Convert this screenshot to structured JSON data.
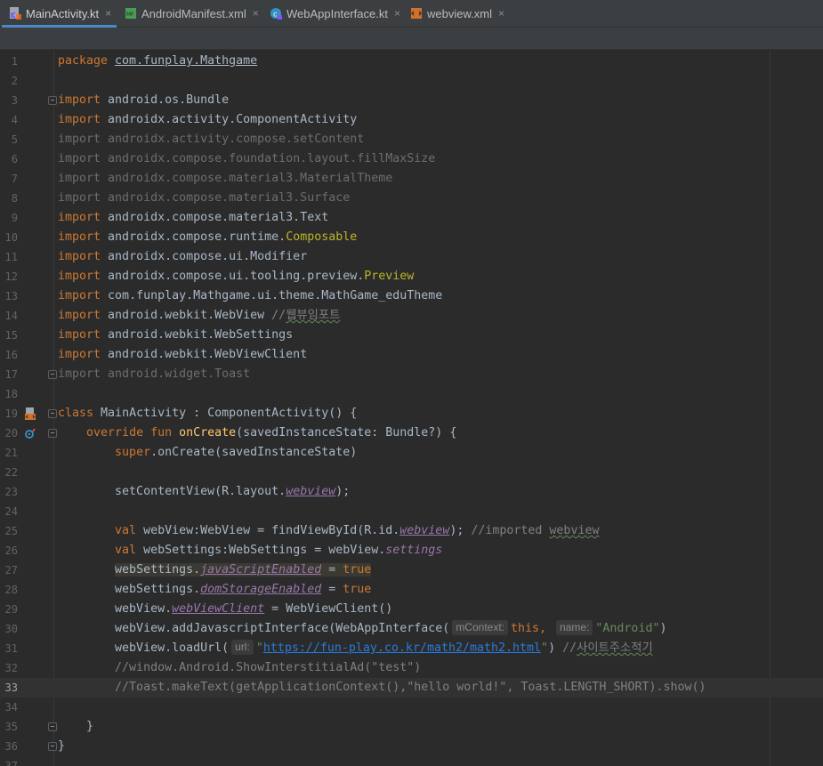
{
  "tabs": [
    {
      "label": "MainActivity.kt",
      "icon": "kotlin-file-icon",
      "active": true
    },
    {
      "label": "AndroidManifest.xml",
      "icon": "manifest-file-icon",
      "active": false
    },
    {
      "label": "WebAppInterface.kt",
      "icon": "kotlin-class-icon",
      "active": false
    },
    {
      "label": "webview.xml",
      "icon": "layout-xml-file-icon",
      "active": false
    }
  ],
  "close_glyph": "×",
  "current_line": 33,
  "colors": {
    "keyword": "#cc7832",
    "function": "#ffc66d",
    "property": "#9876aa",
    "string": "#6a8759",
    "comment": "#808080",
    "annotation": "#bbb529",
    "tab_accent": "#4a88c7"
  },
  "lines": [
    {
      "n": "1",
      "t": [
        [
          "kw",
          "package "
        ],
        [
          "ul",
          "com.funplay.Mathgame"
        ]
      ]
    },
    {
      "n": "2",
      "t": []
    },
    {
      "n": "3",
      "t": [
        [
          "kw",
          "import "
        ],
        [
          "",
          "android.os.Bundle"
        ]
      ],
      "fold": true
    },
    {
      "n": "4",
      "t": [
        [
          "kw",
          "import "
        ],
        [
          "",
          "androidx.activity.ComponentActivity"
        ]
      ]
    },
    {
      "n": "5",
      "t": [
        [
          "dim",
          "import androidx.activity.compose.setContent"
        ]
      ]
    },
    {
      "n": "6",
      "t": [
        [
          "dim",
          "import androidx.compose.foundation.layout.fillMaxSize"
        ]
      ]
    },
    {
      "n": "7",
      "t": [
        [
          "dim",
          "import androidx.compose.material3.MaterialTheme"
        ]
      ]
    },
    {
      "n": "8",
      "t": [
        [
          "dim",
          "import androidx.compose.material3.Surface"
        ]
      ]
    },
    {
      "n": "9",
      "t": [
        [
          "kw",
          "import "
        ],
        [
          "",
          "androidx.compose.material3.Text"
        ]
      ]
    },
    {
      "n": "10",
      "t": [
        [
          "kw",
          "import "
        ],
        [
          "",
          "androidx.compose.runtime."
        ],
        [
          "ann",
          "Composable"
        ]
      ]
    },
    {
      "n": "11",
      "t": [
        [
          "kw",
          "import "
        ],
        [
          "",
          "androidx.compose.ui.Modifier"
        ]
      ]
    },
    {
      "n": "12",
      "t": [
        [
          "kw",
          "import "
        ],
        [
          "",
          "androidx.compose.ui.tooling.preview."
        ],
        [
          "ann",
          "Preview"
        ]
      ]
    },
    {
      "n": "13",
      "t": [
        [
          "kw",
          "import "
        ],
        [
          "",
          "com.funplay.Mathgame.ui.theme.MathGame_eduTheme"
        ]
      ]
    },
    {
      "n": "14",
      "t": [
        [
          "kw",
          "import "
        ],
        [
          "",
          "android.webkit.WebView "
        ],
        [
          "cmt",
          "//"
        ],
        [
          "cmt squig",
          "웹뷰임포트"
        ]
      ]
    },
    {
      "n": "15",
      "t": [
        [
          "kw",
          "import "
        ],
        [
          "",
          "android.webkit.WebSettings"
        ]
      ]
    },
    {
      "n": "16",
      "t": [
        [
          "kw",
          "import "
        ],
        [
          "",
          "android.webkit.WebViewClient"
        ]
      ]
    },
    {
      "n": "17",
      "t": [
        [
          "dim",
          "import android.widget.Toast"
        ]
      ],
      "fold": true
    },
    {
      "n": "18",
      "t": []
    },
    {
      "n": "19",
      "t": [
        [
          "kw",
          "class "
        ],
        [
          "",
          "MainActivity : ComponentActivity() {"
        ]
      ],
      "fold": true,
      "gutter_icon": "layout-xml-file-icon"
    },
    {
      "n": "20",
      "t": [
        [
          "",
          "    "
        ],
        [
          "kw",
          "override fun "
        ],
        [
          "fn",
          "onCreate"
        ],
        [
          "",
          "(savedInstanceState: Bundle?) {"
        ]
      ],
      "fold": true,
      "gutter_icon": "override-method-icon"
    },
    {
      "n": "21",
      "t": [
        [
          "",
          "        "
        ],
        [
          "kw",
          "super"
        ],
        [
          "",
          ".onCreate(savedInstanceState)"
        ]
      ]
    },
    {
      "n": "22",
      "t": []
    },
    {
      "n": "23",
      "t": [
        [
          "",
          "        setContentView(R.layout."
        ],
        [
          "prop ul",
          "webview"
        ],
        [
          "",
          ");"
        ]
      ]
    },
    {
      "n": "24",
      "t": []
    },
    {
      "n": "25",
      "t": [
        [
          "",
          "        "
        ],
        [
          "kw",
          "val "
        ],
        [
          "",
          "webView:WebView = findViewById(R.id."
        ],
        [
          "prop ul",
          "webview"
        ],
        [
          "",
          "); "
        ],
        [
          "cmt",
          "//imported "
        ],
        [
          "cmt squig",
          "webview"
        ]
      ]
    },
    {
      "n": "26",
      "t": [
        [
          "",
          "        "
        ],
        [
          "kw",
          "val "
        ],
        [
          "",
          "webSettings:WebSettings = webView."
        ],
        [
          "prop",
          "settings"
        ]
      ]
    },
    {
      "n": "27",
      "t": [
        [
          "",
          "        "
        ],
        [
          "hl",
          "webSettings."
        ],
        [
          "prop ul hl",
          "javaScriptEnabled"
        ],
        [
          "hl",
          " = "
        ],
        [
          "kw hl",
          "true"
        ]
      ]
    },
    {
      "n": "28",
      "t": [
        [
          "",
          "        webSettings."
        ],
        [
          "prop ul",
          "domStorageEnabled"
        ],
        [
          "",
          " = "
        ],
        [
          "kw",
          "true"
        ]
      ]
    },
    {
      "n": "29",
      "t": [
        [
          "",
          "        webView."
        ],
        [
          "prop ul",
          "webViewClient"
        ],
        [
          "",
          " = WebViewClient()"
        ]
      ]
    },
    {
      "n": "30",
      "t": [
        [
          "",
          "        webView.addJavascriptInterface(WebAppInterface("
        ],
        [
          "hint",
          "mContext:"
        ],
        [
          "kw",
          "this"
        ],
        [
          "kw",
          ", "
        ],
        [
          "hint",
          "name:"
        ],
        [
          "str",
          "\"Android\""
        ],
        [
          "",
          ")"
        ]
      ]
    },
    {
      "n": "31",
      "t": [
        [
          "",
          "        webView.loadUrl("
        ],
        [
          "hint",
          "url:"
        ],
        [
          "str",
          "\""
        ],
        [
          "link",
          "https://fun-play.co.kr/math2/math2.html"
        ],
        [
          "str",
          "\""
        ],
        [
          "",
          ") "
        ],
        [
          "cmt",
          "//"
        ],
        [
          "cmt squig",
          "사이트주소적기"
        ]
      ]
    },
    {
      "n": "32",
      "t": [
        [
          "cmt",
          "        //window.Android.ShowInterstitialAd(\"test\")"
        ]
      ]
    },
    {
      "n": "33",
      "t": [
        [
          "cmt",
          "        //Toast.makeText(getApplicationContext(),\"hello world!\", Toast.LENGTH_SHORT).show()"
        ]
      ]
    },
    {
      "n": "34",
      "t": []
    },
    {
      "n": "35",
      "t": [
        [
          "",
          "    }"
        ]
      ],
      "fold": true
    },
    {
      "n": "36",
      "t": [
        [
          "",
          "}"
        ]
      ],
      "fold": true
    },
    {
      "n": "37",
      "t": []
    }
  ]
}
